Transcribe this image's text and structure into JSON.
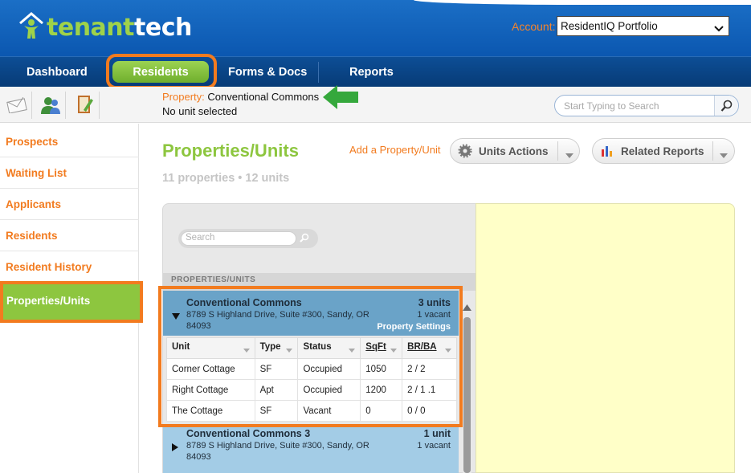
{
  "logo": {
    "part1": "tenant",
    "part2": "tech"
  },
  "account": {
    "label": "Account:",
    "selected": "ResidentIQ Portfolio"
  },
  "nav": {
    "dashboard": "Dashboard",
    "residents": "Residents",
    "forms": "Forms & Docs",
    "reports": "Reports"
  },
  "context": {
    "property_key": "Property:",
    "property_value": "Conventional Commons",
    "unit_status": "No unit selected"
  },
  "top_search": {
    "placeholder": "Start Typing to Search"
  },
  "sidebar": {
    "items": [
      {
        "label": "Prospects"
      },
      {
        "label": "Waiting List"
      },
      {
        "label": "Applicants"
      },
      {
        "label": "Residents"
      },
      {
        "label": "Resident History"
      },
      {
        "label": "Properties/Units"
      }
    ]
  },
  "main": {
    "title": "Properties/Units",
    "add_link": "Add a Property/Unit",
    "units_actions": "Units Actions",
    "related_reports": "Related Reports",
    "counts": "11 properties  • 12 units",
    "search_placeholder": "Search",
    "section_header": "PROPERTIES/UNITS"
  },
  "properties": [
    {
      "name": "Conventional Commons",
      "address": "8789 S Highland Drive, Suite #300, Sandy, OR 84093",
      "units": "3 units",
      "vacant": "1 vacant",
      "settings": "Property Settings"
    },
    {
      "name": "Conventional Commons 3",
      "address": "8789 S Highland Drive, Suite #300, Sandy, OR 84093",
      "units": "1 unit",
      "vacant": "1 vacant"
    }
  ],
  "table": {
    "headers": [
      "Unit",
      "Type",
      "Status",
      "SqFt",
      "BR/BA"
    ],
    "rows": [
      [
        "Corner Cottage",
        "SF",
        "Occupied",
        "1050",
        "2 / 2"
      ],
      [
        "Right Cottage",
        "Apt",
        "Occupied",
        "1200",
        "2 / 1 .1"
      ],
      [
        "The Cottage",
        "SF",
        "Vacant",
        "0",
        "0 / 0"
      ]
    ]
  },
  "colors": {
    "brand_blue": "#0b57b0",
    "accent_orange": "#f27b1f",
    "brand_green": "#8dc63f",
    "detail_yellow": "#ffffc8"
  },
  "icons": [
    "house-person-icon",
    "chevron-down-icon",
    "envelope-icon",
    "people-icon",
    "notebook-icon",
    "search-icon",
    "gear-icon",
    "bar-chart-icon",
    "caret-down-icon",
    "arrow-left-icon",
    "triangle-down-icon",
    "triangle-right-icon",
    "sort-arrow-icon"
  ]
}
